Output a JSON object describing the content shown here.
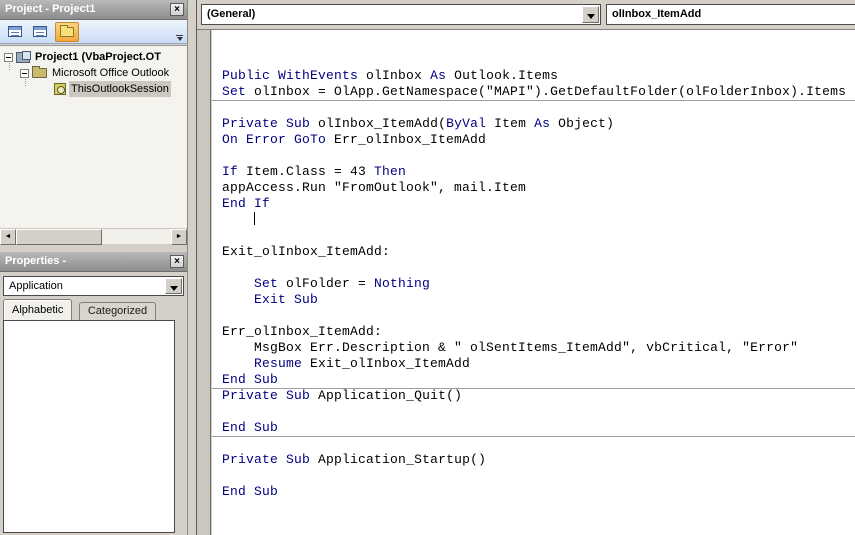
{
  "colors": {
    "keyword": "#000080",
    "code_text": "#000000",
    "selection_bg": "#cbc8c0",
    "toolbar_active": "#f5a93b"
  },
  "project_panel": {
    "title": "Project - Project1",
    "close_icon": "×",
    "toolbar_icons": [
      "view-code-icon",
      "view-object-icon",
      "toggle-folders-icon",
      "toolbar-overflow-icon"
    ],
    "tree": [
      {
        "label": "Project1 (VbaProject.OT"
      },
      {
        "label": "Microsoft Office Outlook"
      },
      {
        "label": "ThisOutlookSession"
      }
    ],
    "hscrollbar": {
      "left_arrow": "◄",
      "right_arrow": "►"
    }
  },
  "properties_panel": {
    "title": "Properties -",
    "close_icon": "×",
    "object_value": "Application",
    "tabs": [
      {
        "label": "Alphabetic"
      },
      {
        "label": "Categorized"
      }
    ]
  },
  "code_window": {
    "object_dropdown": "(General)",
    "procedure_dropdown": "olInbox_ItemAdd",
    "lines": [
      {
        "segs": [
          [
            "k",
            "Public"
          ],
          [
            "t",
            " "
          ],
          [
            "k",
            "WithEvents"
          ],
          [
            "t",
            " olInbox "
          ],
          [
            "k",
            "As"
          ],
          [
            "t",
            " Outlook.Items"
          ]
        ]
      },
      {
        "segs": [
          [
            "k",
            "Set"
          ],
          [
            "t",
            " olInbox = OlApp.GetNamespace(\"MAPI\").GetDefaultFolder(olFolderInbox).Items"
          ]
        ]
      },
      {
        "sep": true,
        "segs": []
      },
      {
        "segs": [
          [
            "k",
            "Private"
          ],
          [
            "t",
            " "
          ],
          [
            "k",
            "Sub"
          ],
          [
            "t",
            " olInbox_ItemAdd("
          ],
          [
            "k",
            "ByVal"
          ],
          [
            "t",
            " Item "
          ],
          [
            "k",
            "As"
          ],
          [
            "t",
            " Object)"
          ]
        ]
      },
      {
        "segs": [
          [
            "k",
            "On Error GoTo"
          ],
          [
            "t",
            " Err_olInbox_ItemAdd"
          ]
        ]
      },
      {
        "segs": []
      },
      {
        "segs": [
          [
            "k",
            "If"
          ],
          [
            "t",
            " Item.Class = 43 "
          ],
          [
            "k",
            "Then"
          ]
        ]
      },
      {
        "segs": [
          [
            "t",
            "appAccess.Run \"FromOutlook\", mail.Item"
          ]
        ]
      },
      {
        "segs": [
          [
            "k",
            "End If"
          ]
        ]
      },
      {
        "caret": true,
        "segs": [
          [
            "t",
            "    "
          ]
        ]
      },
      {
        "segs": []
      },
      {
        "segs": [
          [
            "t",
            "Exit_olInbox_ItemAdd:"
          ]
        ]
      },
      {
        "segs": []
      },
      {
        "segs": [
          [
            "t",
            "    "
          ],
          [
            "k",
            "Set"
          ],
          [
            "t",
            " olFolder = "
          ],
          [
            "k",
            "Nothing"
          ]
        ]
      },
      {
        "segs": [
          [
            "t",
            "    "
          ],
          [
            "k",
            "Exit Sub"
          ]
        ]
      },
      {
        "segs": []
      },
      {
        "segs": [
          [
            "t",
            "Err_olInbox_ItemAdd:"
          ]
        ]
      },
      {
        "segs": [
          [
            "t",
            "    MsgBox Err.Description & \" olSentItems_ItemAdd\", vbCritical, \"Error\""
          ]
        ]
      },
      {
        "segs": [
          [
            "t",
            "    "
          ],
          [
            "k",
            "Resume"
          ],
          [
            "t",
            " Exit_olInbox_ItemAdd"
          ]
        ]
      },
      {
        "segs": [
          [
            "k",
            "End Sub"
          ]
        ]
      },
      {
        "sep": true,
        "segs": [
          [
            "k",
            "Private"
          ],
          [
            "t",
            " "
          ],
          [
            "k",
            "Sub"
          ],
          [
            "t",
            " Application_Quit()"
          ]
        ]
      },
      {
        "segs": []
      },
      {
        "segs": [
          [
            "k",
            "End Sub"
          ]
        ]
      },
      {
        "sep": true,
        "segs": []
      },
      {
        "segs": [
          [
            "k",
            "Private"
          ],
          [
            "t",
            " "
          ],
          [
            "k",
            "Sub"
          ],
          [
            "t",
            " Application_Startup()"
          ]
        ]
      },
      {
        "segs": []
      },
      {
        "segs": [
          [
            "k",
            "End Sub"
          ]
        ]
      }
    ]
  }
}
